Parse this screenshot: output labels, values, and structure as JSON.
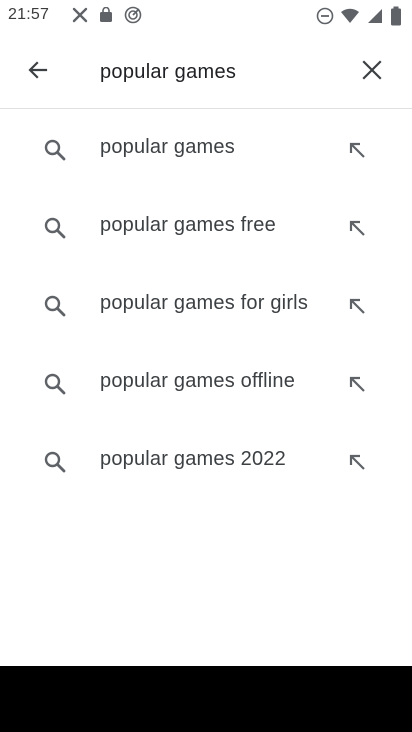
{
  "status_bar": {
    "time": "21:57",
    "left_icons": [
      "x-notification-icon",
      "shopping-bag-icon",
      "signal-radar-icon"
    ],
    "right_icons": [
      "do-not-disturb-icon",
      "wifi-icon",
      "cellular-icon",
      "battery-icon"
    ]
  },
  "search": {
    "back_icon": "arrow-back-icon",
    "query": "popular games",
    "clear_icon": "close-icon"
  },
  "suggestions": [
    {
      "text": "popular games"
    },
    {
      "text": "popular games free"
    },
    {
      "text": "popular games for girls"
    },
    {
      "text": "popular games offline"
    },
    {
      "text": "popular games 2022"
    }
  ],
  "colors": {
    "text_primary": "#202124",
    "icon_gray": "#5f6368",
    "divider": "#e0e0e0",
    "nav_bar": "#000000"
  }
}
